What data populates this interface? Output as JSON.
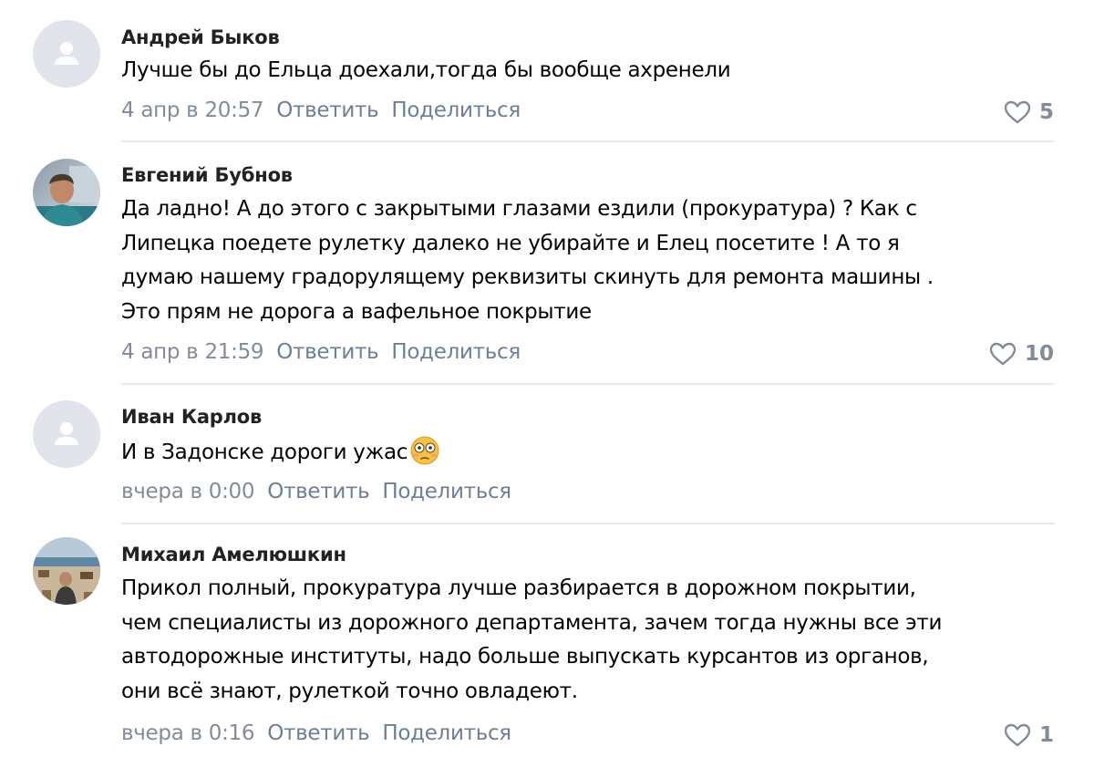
{
  "actions": {
    "reply": "Ответить",
    "share": "Поделиться"
  },
  "colors": {
    "link_gray": "#818c99",
    "divider": "#e7e8ec",
    "placeholder_avatar": "#e1e5eb"
  },
  "comments": [
    {
      "author": "Андрей Быков",
      "avatar": "user-placeholder-icon",
      "text_lines": [
        "Лучше бы до Ельца доехали,тогда бы вообще ахренели"
      ],
      "date": "4 апр в 20:57",
      "likes": "5"
    },
    {
      "author": "Евгений Бубнов",
      "avatar": "profile-photo",
      "text_lines": [
        "Да ладно! А до этого с закрытыми глазами ездили (прокуратура) ? Как с",
        "Липецка поедете рулетку далеко не убирайте и Елец посетите ! А то я",
        "думаю нашему градорулящему реквизиты скинуть для ремонта машины .",
        "Это прям не дорога а вафельное покрытие"
      ],
      "date": "4 апр в 21:59",
      "likes": "10"
    },
    {
      "author": "Иван Карлов",
      "avatar": "user-placeholder-icon",
      "text_lines": [
        "И в Задонске дороги ужас"
      ],
      "emoji": "flushed-face-emoji",
      "date": "вчера в 0:00",
      "likes": ""
    },
    {
      "author": "Михаил Амелюшкин",
      "avatar": "profile-photo",
      "text_lines": [
        "Прикол полный, прокуратура лучше разбирается в дорожном покрытии,",
        "чем специалисты из дорожного департамента, зачем тогда нужны все эти",
        "автодорожные институты, надо больше выпускать курсантов из органов,",
        "они всё знают, рулеткой точно овладеют."
      ],
      "date": "вчера в 0:16",
      "likes": "1"
    }
  ]
}
